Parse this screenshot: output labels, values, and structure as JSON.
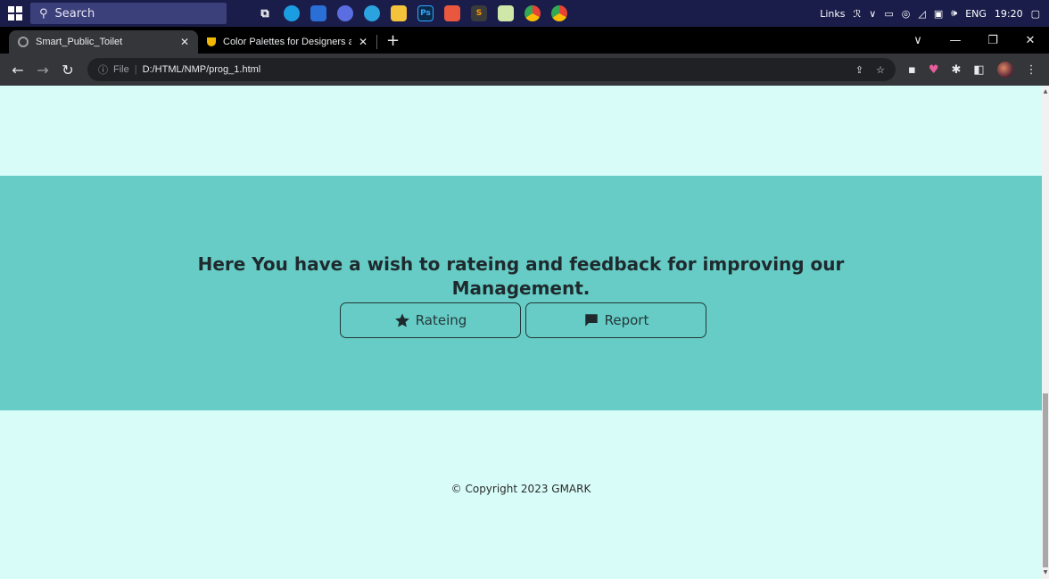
{
  "taskbar": {
    "search_placeholder": "Search",
    "tray": {
      "links_label": "Links",
      "language": "ENG",
      "time": "19:20"
    }
  },
  "browser": {
    "tabs": [
      {
        "title": "Smart_Public_Toilet",
        "active": true
      },
      {
        "title": "Color Palettes for Designers and",
        "active": false
      }
    ],
    "address": {
      "scheme_label": "File",
      "url": "D:/HTML/NMP/prog_1.html"
    }
  },
  "page": {
    "rating_section": {
      "heading": "Here You have a wish to rateing and feedback for improving our Management.",
      "rating_button_label": "Rateing",
      "report_button_label": "Report"
    },
    "footer": {
      "copyright": "© Copyright 2023 GMARK"
    }
  },
  "colors": {
    "page_background": "#d8fdf9",
    "section_background": "#66ccc5",
    "taskbar_background": "#1a1d4a"
  }
}
